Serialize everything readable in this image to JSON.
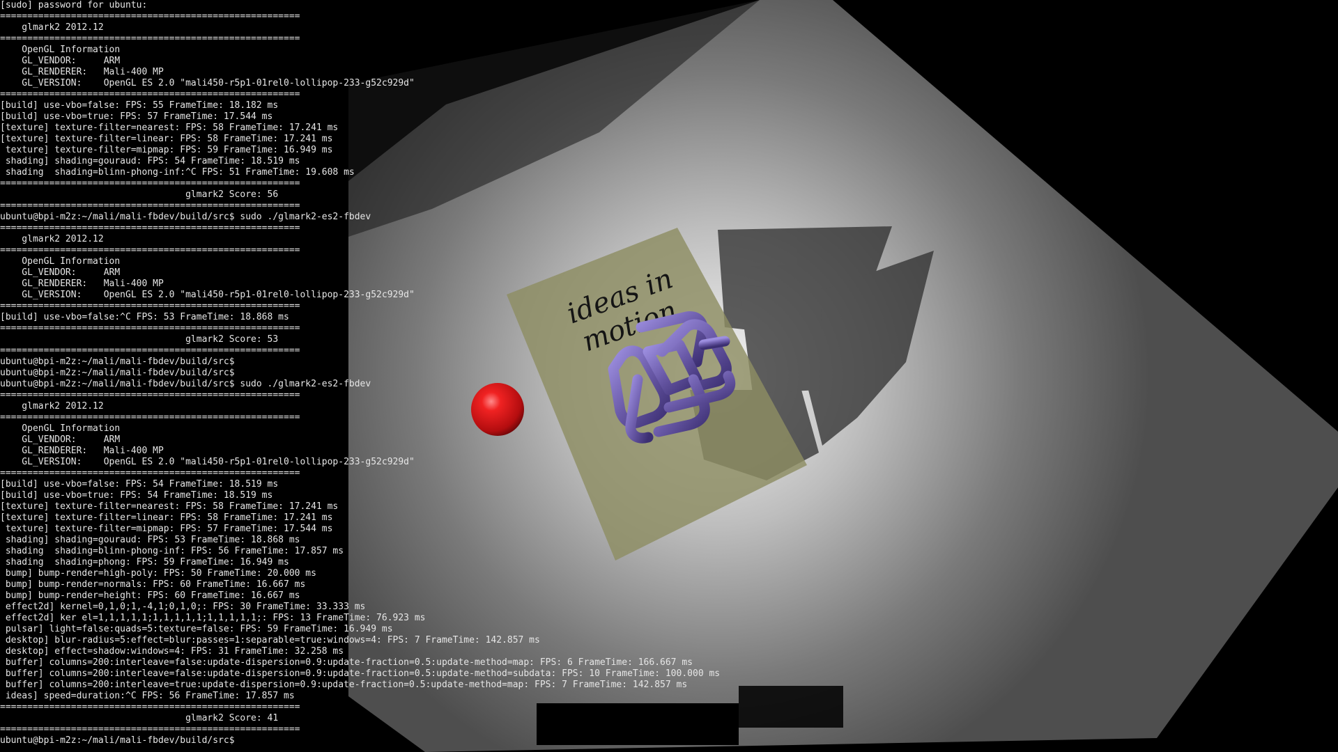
{
  "scene": {
    "poster_text_line1": "ideas in",
    "poster_text_line2": "motion",
    "colors": {
      "floor": "#6f6f6f",
      "floor_highlight": "#f2f2f2",
      "poster": "#8d8d63",
      "tubes": "#6a5aa8",
      "ball": "#e0191b",
      "shadow": "#2f2f2f"
    }
  },
  "terminal": {
    "lines": [
      "[sudo] password for ubuntu:",
      "=======================================================",
      "    glmark2 2012.12",
      "=======================================================",
      "    OpenGL Information",
      "    GL_VENDOR:     ARM",
      "    GL_RENDERER:   Mali-400 MP",
      "    GL_VERSION:    OpenGL ES 2.0 \"mali450-r5p1-01rel0-lollipop-233-g52c929d\"",
      "=======================================================",
      "[build] use-vbo=false: FPS: 55 FrameTime: 18.182 ms",
      "[build] use-vbo=true: FPS: 57 FrameTime: 17.544 ms",
      "[texture] texture-filter=nearest: FPS: 58 FrameTime: 17.241 ms",
      "[texture] texture-filter=linear: FPS: 58 FrameTime: 17.241 ms",
      " texture] texture-filter=mipmap: FPS: 59 FrameTime: 16.949 ms",
      " shading] shading=gouraud: FPS: 54 FrameTime: 18.519 ms",
      " shading  shading=blinn-phong-inf:^C FPS: 51 FrameTime: 19.608 ms",
      "=======================================================",
      "                                  glmark2 Score: 56",
      "=======================================================",
      "ubuntu@bpi-m2z:~/mali/mali-fbdev/build/src$ sudo ./glmark2-es2-fbdev",
      "=======================================================",
      "    glmark2 2012.12",
      "=======================================================",
      "    OpenGL Information",
      "    GL_VENDOR:     ARM",
      "    GL_RENDERER:   Mali-400 MP",
      "    GL_VERSION:    OpenGL ES 2.0 \"mali450-r5p1-01rel0-lollipop-233-g52c929d\"",
      "=======================================================",
      "[build] use-vbo=false:^C FPS: 53 FrameTime: 18.868 ms",
      "=======================================================",
      "                                  glmark2 Score: 53",
      "=======================================================",
      "ubuntu@bpi-m2z:~/mali/mali-fbdev/build/src$",
      "ubuntu@bpi-m2z:~/mali/mali-fbdev/build/src$",
      "ubuntu@bpi-m2z:~/mali/mali-fbdev/build/src$ sudo ./glmark2-es2-fbdev",
      "=======================================================",
      "    glmark2 2012.12",
      "=======================================================",
      "    OpenGL Information",
      "    GL_VENDOR:     ARM",
      "    GL_RENDERER:   Mali-400 MP",
      "    GL_VERSION:    OpenGL ES 2.0 \"mali450-r5p1-01rel0-lollipop-233-g52c929d\"",
      "=======================================================",
      "[build] use-vbo=false: FPS: 54 FrameTime: 18.519 ms",
      "[build] use-vbo=true: FPS: 54 FrameTime: 18.519 ms",
      "[texture] texture-filter=nearest: FPS: 58 FrameTime: 17.241 ms",
      "[texture] texture-filter=linear: FPS: 58 FrameTime: 17.241 ms",
      " texture] texture-filter=mipmap: FPS: 57 FrameTime: 17.544 ms",
      " shading] shading=gouraud: FPS: 53 FrameTime: 18.868 ms",
      " shading  shading=blinn-phong-inf: FPS: 56 FrameTime: 17.857 ms",
      " shading  shading=phong: FPS: 59 FrameTime: 16.949 ms",
      " bump] bump-render=high-poly: FPS: 50 FrameTime: 20.000 ms",
      " bump] bump-render=normals: FPS: 60 FrameTime: 16.667 ms",
      " bump] bump-render=height: FPS: 60 FrameTime: 16.667 ms",
      " effect2d] kernel=0,1,0;1,-4,1;0,1,0;: FPS: 30 FrameTime: 33.333 ms",
      " effect2d] ker el=1,1,1,1,1;1,1,1,1,1;1,1,1,1,1;: FPS: 13 FrameTime: 76.923 ms",
      " pulsar] light=false:quads=5:texture=false: FPS: 59 FrameTime: 16.949 ms",
      " desktop] blur-radius=5:effect=blur:passes=1:separable=true:windows=4: FPS: 7 FrameTime: 142.857 ms",
      " desktop] effect=shadow:windows=4: FPS: 31 FrameTime: 32.258 ms",
      " buffer] columns=200:interleave=false:update-dispersion=0.9:update-fraction=0.5:update-method=map: FPS: 6 FrameTime: 166.667 ms",
      " buffer] columns=200:interleave=false:update-dispersion=0.9:update-fraction=0.5:update-method=subdata: FPS: 10 FrameTime: 100.000 ms",
      " buffer] columns=200:interleave=true:update-dispersion=0.9:update-fraction=0.5:update-method=map: FPS: 7 FrameTime: 142.857 ms",
      " ideas] speed=duration:^C FPS: 56 FrameTime: 17.857 ms",
      "=======================================================",
      "                                  glmark2 Score: 41",
      "=======================================================",
      "ubuntu@bpi-m2z:~/mali/mali-fbdev/build/src$"
    ]
  }
}
